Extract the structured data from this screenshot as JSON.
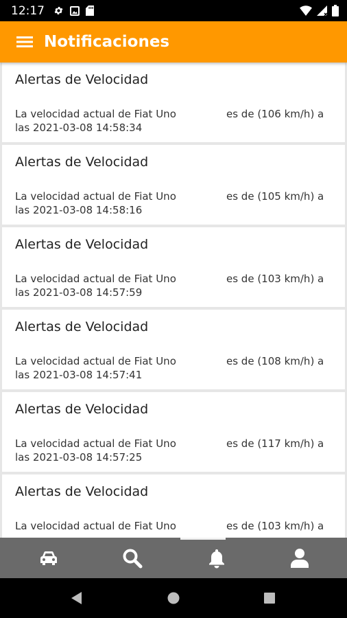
{
  "status_bar": {
    "time": "12:17",
    "left_icons": [
      "gear-icon",
      "image-notification-icon",
      "sd-card-icon"
    ],
    "right_icons": [
      "wifi-icon",
      "signal-icon",
      "battery-icon"
    ]
  },
  "app_bar": {
    "title": "Notificaciones",
    "background": "#ff9800"
  },
  "notifications": [
    {
      "title": "Alertas de Velocidad",
      "line1_start": "La velocidad actual de Fiat Uno",
      "line1_end": "es de (106 km/h) a",
      "line2": "las 2021-03-08 14:58:34"
    },
    {
      "title": "Alertas de Velocidad",
      "line1_start": "La velocidad actual de Fiat Uno",
      "line1_end": "es de (105 km/h) a",
      "line2": "las 2021-03-08 14:58:16"
    },
    {
      "title": "Alertas de Velocidad",
      "line1_start": "La velocidad actual de Fiat Uno",
      "line1_end": "es de (103 km/h) a",
      "line2": "las 2021-03-08 14:57:59"
    },
    {
      "title": "Alertas de Velocidad",
      "line1_start": "La velocidad actual de Fiat Uno",
      "line1_end": "es de (108 km/h) a",
      "line2": "las 2021-03-08 14:57:41"
    },
    {
      "title": "Alertas de Velocidad",
      "line1_start": "La velocidad actual de Fiat Uno",
      "line1_end": "es de (117 km/h) a",
      "line2": "las 2021-03-08 14:57:25"
    },
    {
      "title": "Alertas de Velocidad",
      "line1_start": "La velocidad actual de Fiat Uno",
      "line1_end": "es de (103 km/h) a",
      "line2": ""
    }
  ],
  "bottom_nav": {
    "items": [
      "car-icon",
      "search-icon",
      "bell-icon",
      "person-icon"
    ],
    "active": "bell-icon",
    "background": "#6a6a6a"
  },
  "system_nav": {
    "buttons": [
      "back-icon",
      "home-icon",
      "recents-icon"
    ]
  }
}
